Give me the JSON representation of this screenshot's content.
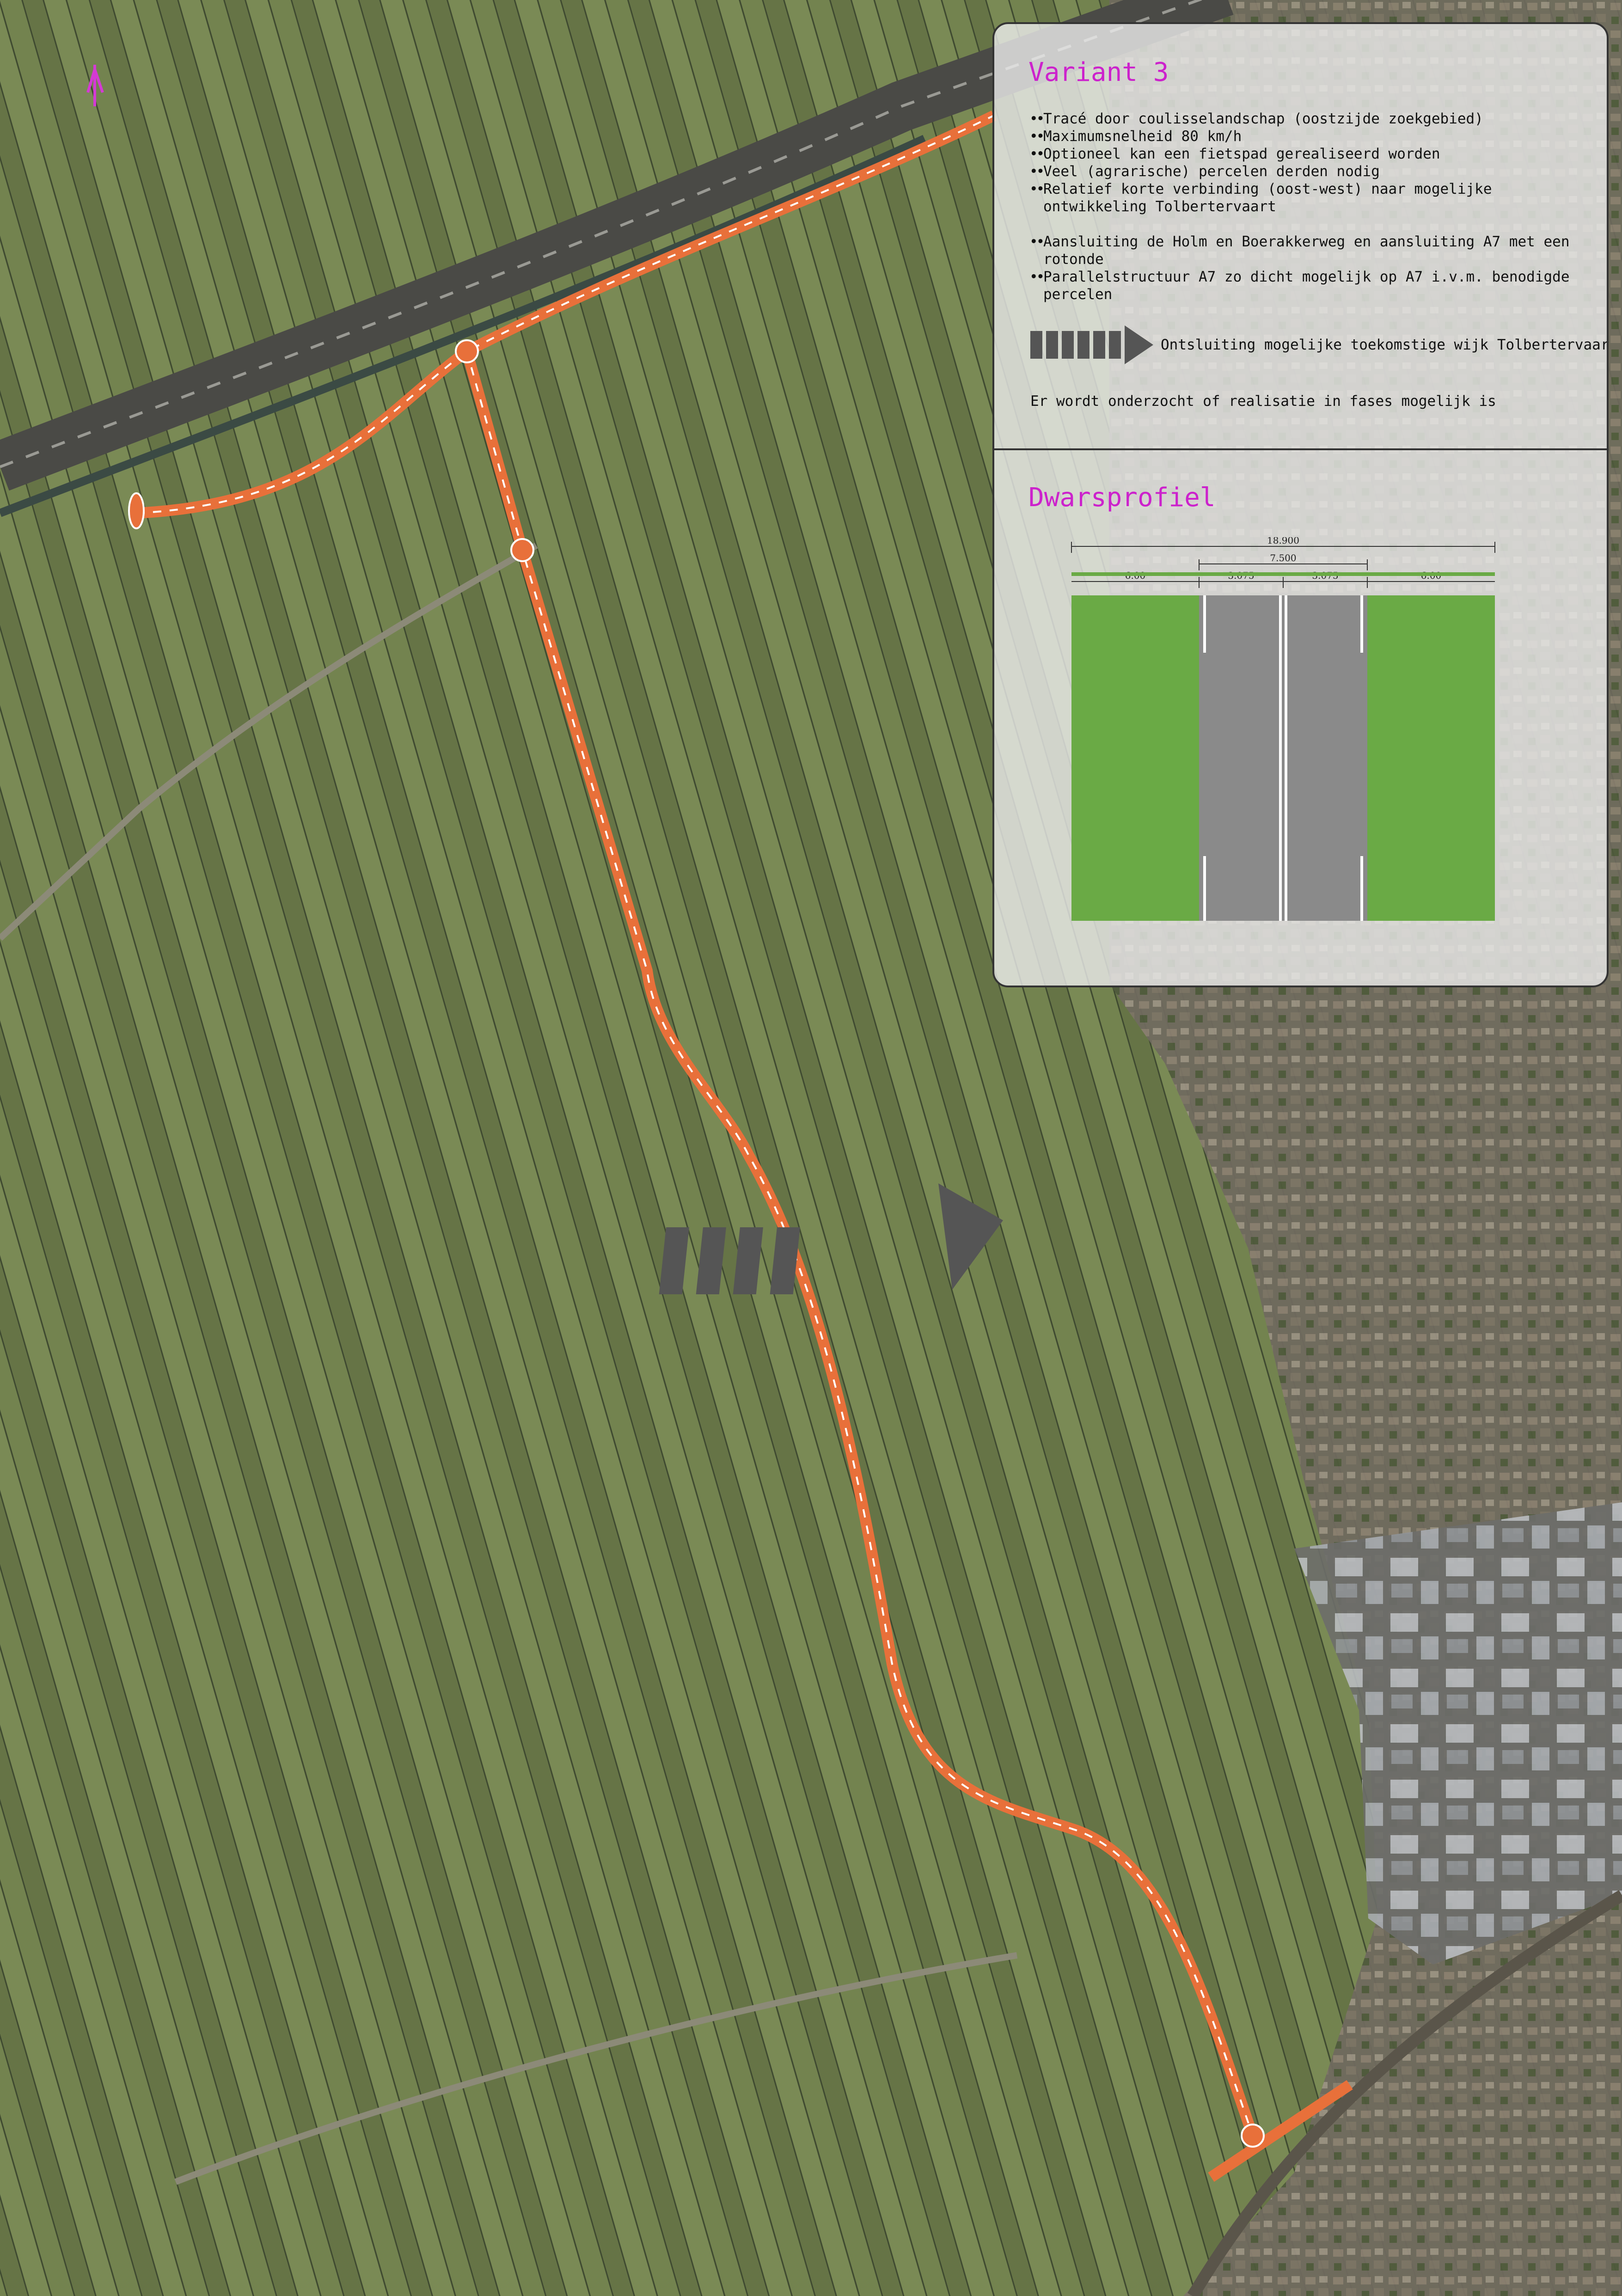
{
  "panel": {
    "title": "Variant 3",
    "bullets_group1": [
      "Tracé door coulisselandschap (oostzijde zoekgebied)",
      "Maximumsnelheid 80 km/h",
      "Optioneel kan een fietspad gerealiseerd worden",
      "Veel (agrarische) percelen derden nodig",
      "Relatief korte verbinding (oost-west) naar mogelijke ontwikkeling Tolbertervaart"
    ],
    "bullets_group2": [
      "Aansluiting de Holm en Boerakkerweg en aansluiting A7 met een rotonde",
      "Parallelstructuur A7 zo dicht mogelijk op A7 i.v.m. benodigde percelen"
    ],
    "arrow_legend": "Ontsluiting mogelijke toekomstige wijk Tolbertervaart",
    "note": "Er wordt onderzocht of realisatie in fases mogelijk is",
    "section_title": "Dwarsprofiel"
  },
  "profile": {
    "total": "18.900",
    "carriageway": "7.500",
    "verge_left": "6.00",
    "lane_left": "3.075",
    "lane_right": "3.075",
    "verge_right": "6.00"
  },
  "colors": {
    "route": "#e8703a",
    "accent_title": "#cc22cc",
    "arrow": "#555555",
    "verge": "#6aaa45",
    "asphalt": "#8a8a8a"
  }
}
